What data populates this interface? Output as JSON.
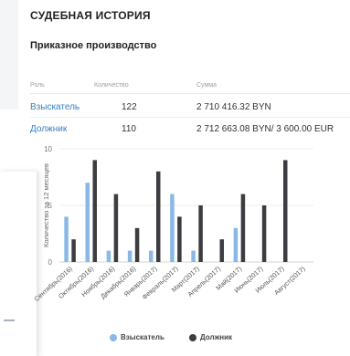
{
  "page": {
    "section_title": "СУДЕБНАЯ ИСТОРИЯ",
    "subsection_title": "Приказное производство"
  },
  "table": {
    "headers": {
      "role": "Роль",
      "quantity": "Количество",
      "sum": "Сумма"
    },
    "rows": [
      {
        "role": "Взыскатель",
        "quantity": "122",
        "sum": "2 710 416.32 BYN"
      },
      {
        "role": "Должник",
        "quantity": "110",
        "sum": "2 712 663.08 BYN/ 3 600.00 EUR"
      }
    ]
  },
  "colors": {
    "series_1": "#8ab8e6",
    "series_2": "#3b3d40",
    "link": "#3a7fc4"
  },
  "chart_data": {
    "type": "bar",
    "ylabel": "Количество за 12 месяцев",
    "ylim": [
      0,
      10
    ],
    "yticks": [
      0,
      5,
      10
    ],
    "grid": true,
    "legend_position": "bottom",
    "categories": [
      "Сентябрь(2016)",
      "Октябрь(2016)",
      "Ноябрь(2016)",
      "Декабрь(2016)",
      "Январь(2017)",
      "Февраль(2017)",
      "Март(2017)",
      "Апрель(2017)",
      "Май(2017)",
      "Июнь(2017)",
      "Июль(2017)",
      "Август(2017)"
    ],
    "series": [
      {
        "name": "Взыскатель",
        "values": [
          4,
          7,
          1,
          1,
          1,
          6,
          1,
          0,
          3,
          0,
          0,
          0
        ]
      },
      {
        "name": "Должник",
        "values": [
          2,
          9,
          6,
          3,
          8,
          4,
          5,
          2,
          6,
          5,
          9,
          0
        ]
      }
    ]
  }
}
